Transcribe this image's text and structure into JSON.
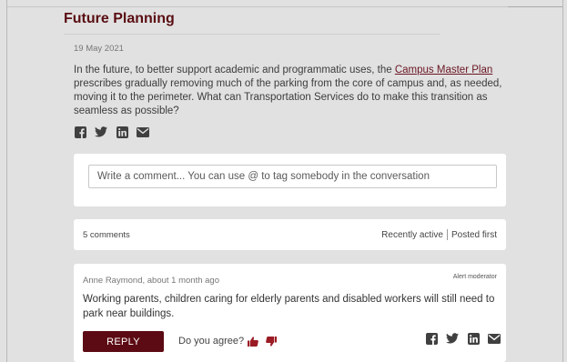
{
  "page": {
    "title": "Future Planning"
  },
  "post": {
    "date": "19 May 2021",
    "body_before": "In the future, to better support academic and programmatic uses, the ",
    "link_text": "Campus Master Plan",
    "body_after": " prescribes gradually removing much of the parking from the core of campus and, as needed, moving it to the perimeter. What can Transportation Services do to make this transition as seamless as possible?"
  },
  "share": {
    "icons": [
      "facebook-icon",
      "twitter-icon",
      "linkedin-icon",
      "email-icon"
    ],
    "color": "#404040"
  },
  "comment_box": {
    "placeholder": "Write a comment... You can use @ to tag somebody in the conversation"
  },
  "comments_bar": {
    "count": "5 comments",
    "sort_active": "Recently active",
    "sort_first": "Posted first"
  },
  "comment": {
    "author": "Anne Raymond, about 1 month ago",
    "alert": "Alert moderator",
    "text": "Working parents, children caring for elderly parents and disabled workers will still need to park near buildings.",
    "reply_label": "REPLY",
    "agree_label": "Do you agree?"
  },
  "colors": {
    "brand": "#5c0a13",
    "vote": "#9b1b24"
  }
}
